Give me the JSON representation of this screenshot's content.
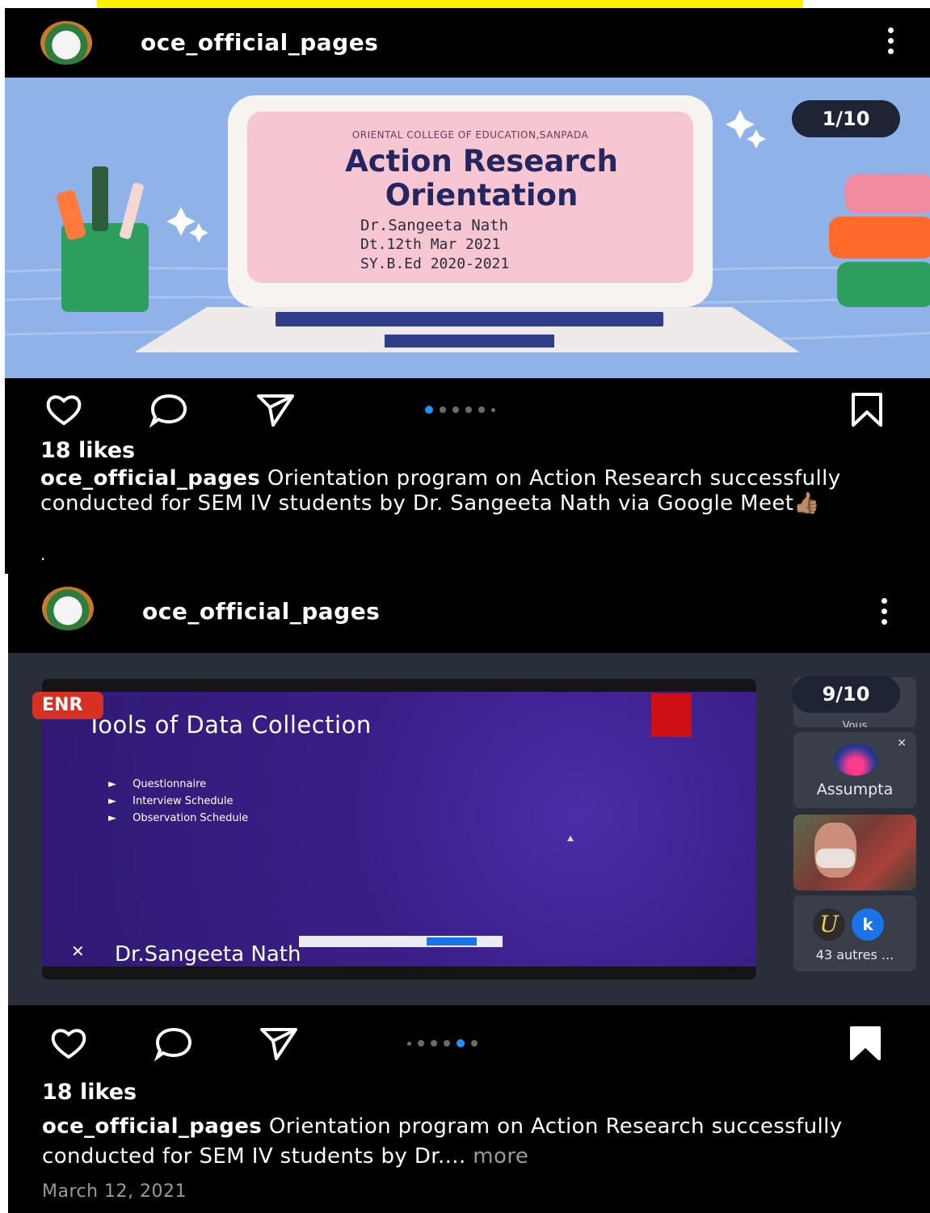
{
  "post1": {
    "username": "oce_official_pages",
    "slide_counter": "1/10",
    "slide": {
      "college": "ORIENTAL COLLEGE OF EDUCATION,SANPADA",
      "title_line1": "Action Research",
      "title_line2": "Orientation",
      "speaker": "Dr.Sangeeta Nath",
      "date": "Dt.12th Mar 2021",
      "batch": "SY.B.Ed 2020-2021"
    },
    "likes": "18 likes",
    "caption_user": "oce_official_pages",
    "caption_text": " Orientation program on Action Research successfully conducted for SEM IV students by Dr. Sangeeta Nath via Google Meet",
    "caption_emoji": "👍🏽",
    "extra_line": "."
  },
  "post2": {
    "username": "oce_official_pages",
    "slide_counter": "9/10",
    "meet": {
      "rec_badge": "ENR",
      "slide_title": "Tools of Data Collection",
      "bullets": [
        "Questionnaire",
        "Interview Schedule",
        "Observation Schedule"
      ],
      "presenter": "Dr.Sangeeta Nath",
      "tile_top_label": "Vous",
      "participant_name": "Assumpta",
      "avatar_initial_1": "U",
      "avatar_initial_2": "k",
      "others": "43 autres ..."
    },
    "likes": "18 likes",
    "caption_user": "oce_official_pages",
    "caption_text": " Orientation program on Action Research successfully conducted for SEM IV students by Dr....",
    "more": " more",
    "date": "March 12, 2021"
  },
  "colors": {
    "background": "#000000",
    "accent_blue": "#1e90ff",
    "slide_bg": "#8fb3e8",
    "slide_pink": "#f7c6d3",
    "meet_purple": "#3b1f8a",
    "rec_red": "#d93025"
  }
}
